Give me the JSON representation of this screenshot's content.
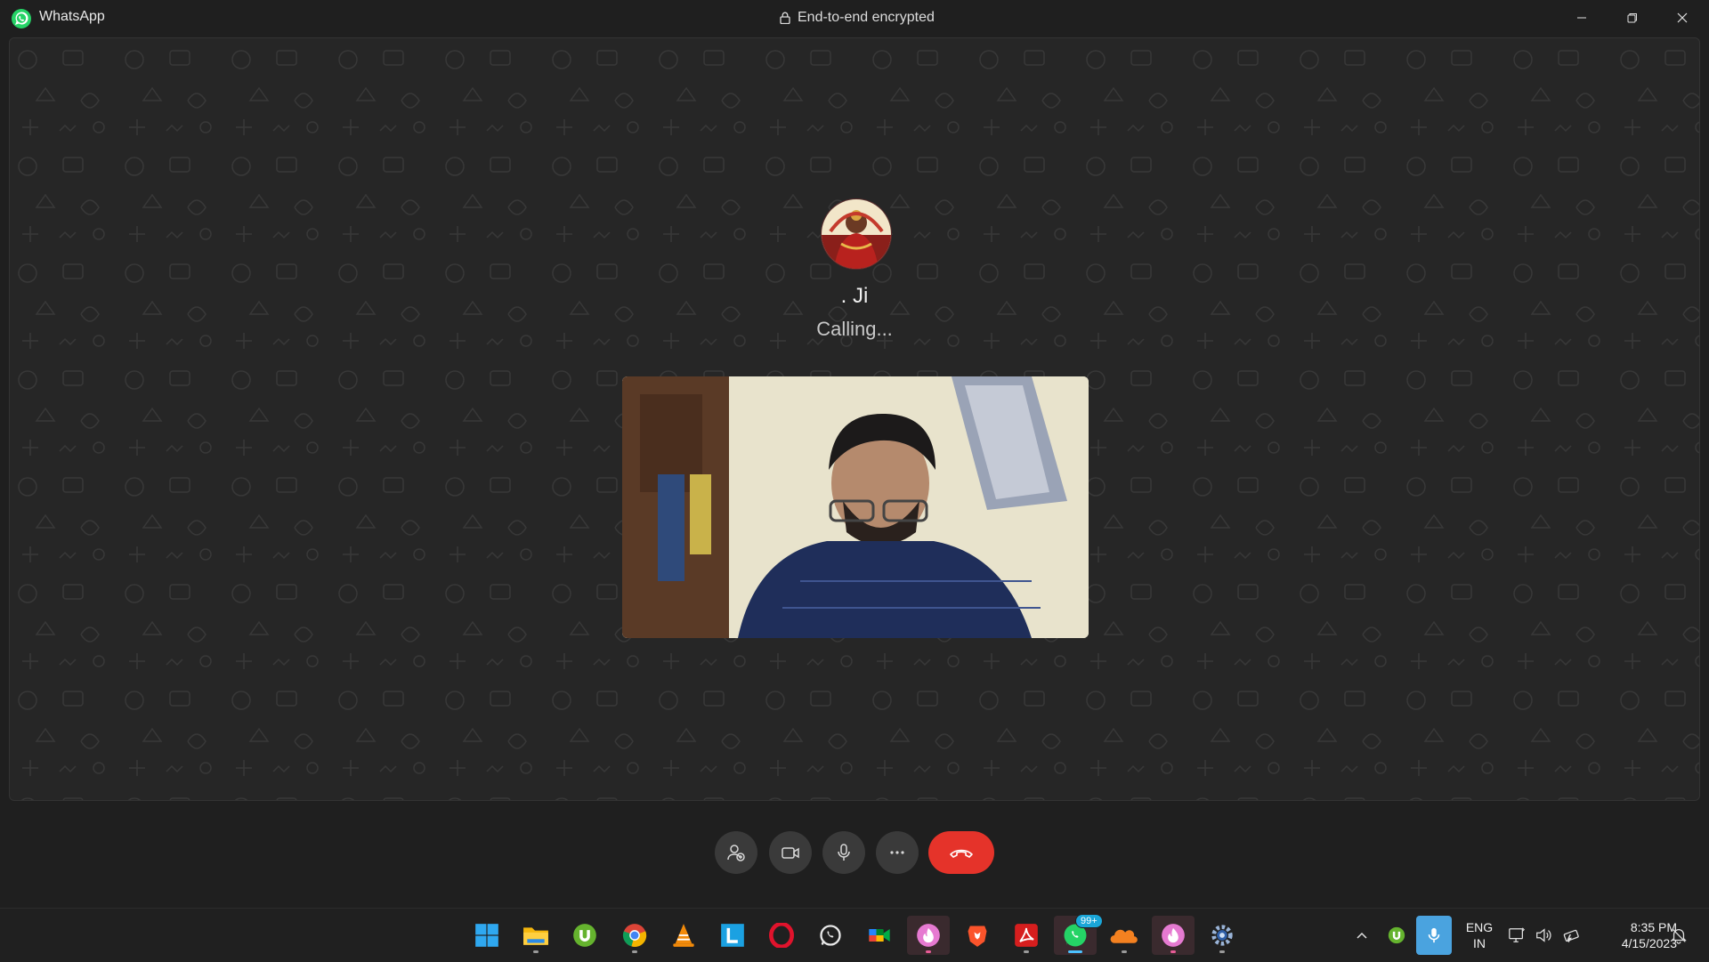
{
  "window": {
    "title": "WhatsApp",
    "encryption_label": "End-to-end encrypted",
    "icon": "whatsapp-logo"
  },
  "call": {
    "contact_name": ". Ji",
    "status": "Calling...",
    "avatar_icon": "contact-avatar",
    "self_view": "camera-preview"
  },
  "controls": {
    "add_participant_icon": "add-participant-icon",
    "video_icon": "video-camera-icon",
    "mic_icon": "microphone-icon",
    "more_icon": "more-options-icon",
    "end_call_icon": "end-call-icon",
    "end_call_color": "#e5332a"
  },
  "taskbar": {
    "apps": [
      {
        "name": "start",
        "icon": "windows-start-icon"
      },
      {
        "name": "file-explorer",
        "icon": "folder-icon"
      },
      {
        "name": "utorrent",
        "icon": "utorrent-icon"
      },
      {
        "name": "chrome",
        "icon": "chrome-icon"
      },
      {
        "name": "vlc",
        "icon": "vlc-icon"
      },
      {
        "name": "l-app",
        "icon": "l-app-icon"
      },
      {
        "name": "opera",
        "icon": "opera-icon"
      },
      {
        "name": "whatsapp-alt",
        "icon": "whatsapp-outline-icon"
      },
      {
        "name": "google-meet",
        "icon": "meet-icon"
      },
      {
        "name": "pink-app-1",
        "icon": "flame-app-icon"
      },
      {
        "name": "brave",
        "icon": "brave-icon"
      },
      {
        "name": "acrobat",
        "icon": "acrobat-icon"
      },
      {
        "name": "whatsapp",
        "icon": "whatsapp-icon",
        "badge": "99+"
      },
      {
        "name": "cloud-app",
        "icon": "cloud-icon"
      },
      {
        "name": "pink-app-2",
        "icon": "flame-app-icon"
      },
      {
        "name": "settings",
        "icon": "gear-icon"
      }
    ],
    "tray": {
      "language_line1": "ENG",
      "language_line2": "IN",
      "time": "8:35 PM",
      "date": "4/15/2023"
    }
  },
  "colors": {
    "accent": "#4cc2ff",
    "whatsapp_green": "#25d366",
    "background": "#1f1f1f"
  }
}
